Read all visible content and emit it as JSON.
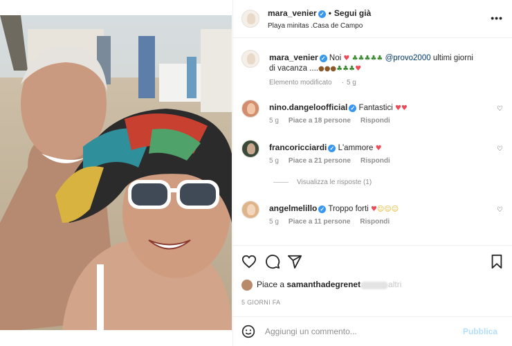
{
  "post": {
    "author": "mara_venier",
    "follow_state": "Segui già",
    "location": "Playa minitas .Casa de Campo",
    "more_icon": "more-options-icon"
  },
  "caption": {
    "author": "mara_venier",
    "text_before": "Noi",
    "mention": "@provo2000",
    "text_after": "ultimi giorni",
    "text_line2": "di vacanza ....",
    "edited": "Elemento modificato",
    "age": "5 g"
  },
  "comments": [
    {
      "user": "nino.dangeloofficial",
      "text": "Fantastici",
      "age": "5 g",
      "likes": "Piace a 18 persone",
      "reply": "Rispondi"
    },
    {
      "user": "francoricciardi",
      "text": "L'ammore",
      "age": "5 g",
      "likes": "Piace a 21 persone",
      "reply": "Rispondi",
      "view_replies": "Visualizza le risposte (1)"
    },
    {
      "user": "angelmelillo",
      "text": "Troppo forti",
      "age": "5 g",
      "likes": "Piace a 11 persone",
      "reply": "Rispondi"
    }
  ],
  "likes_line": {
    "prefix": "Piace a",
    "user": "samanthadegrenet",
    "suffix": "altri"
  },
  "date": "5 GIORNI FA",
  "composer": {
    "placeholder": "Aggiungi un commento...",
    "publish": "Pubblica"
  },
  "colors": {
    "verified": "#3897f0",
    "heart": "#ed4956",
    "publish_disabled": "#b2dffc",
    "secondary_text": "#8e8e8e"
  }
}
